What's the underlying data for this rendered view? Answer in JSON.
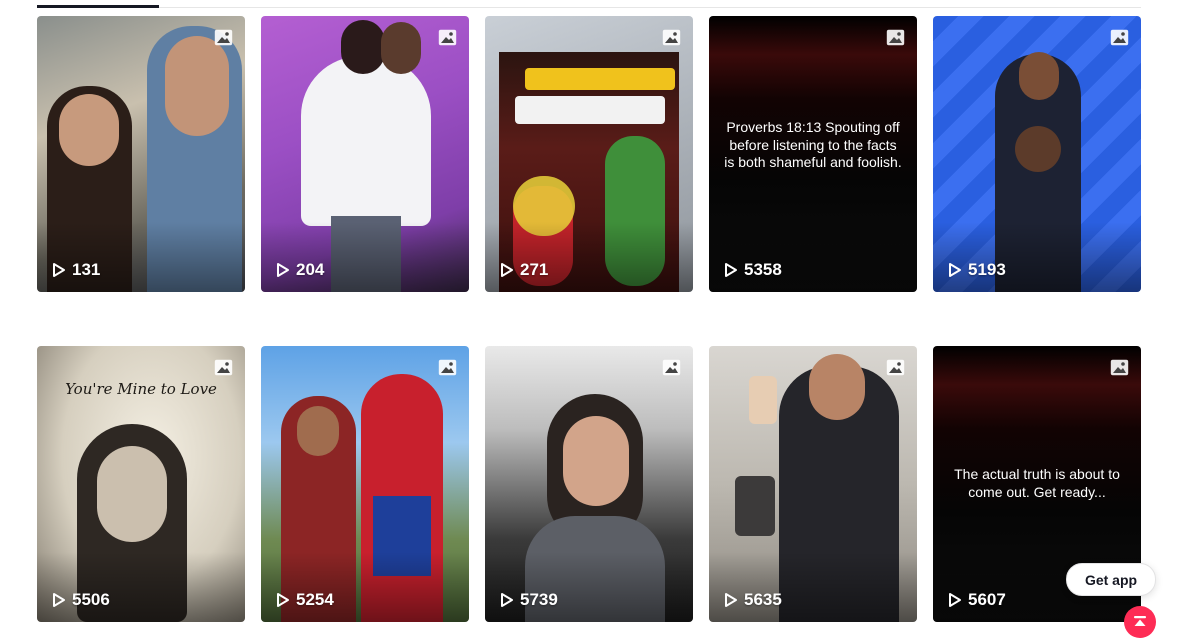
{
  "tabs": {
    "active_index": 0
  },
  "videos": [
    {
      "views": "131",
      "type": "photo"
    },
    {
      "views": "204",
      "type": "photo"
    },
    {
      "views": "271",
      "type": "photo"
    },
    {
      "views": "5358",
      "type": "photo",
      "caption": "Proverbs 18:13 Spouting off before listening to the facts is both shameful and foolish."
    },
    {
      "views": "5193",
      "type": "photo"
    },
    {
      "views": "5506",
      "type": "photo",
      "overlay_text": "You're Mine to Love"
    },
    {
      "views": "5254",
      "type": "photo"
    },
    {
      "views": "5739",
      "type": "photo"
    },
    {
      "views": "5635",
      "type": "photo"
    },
    {
      "views": "5607",
      "type": "photo",
      "caption": "The actual truth is about to come out. Get ready..."
    }
  ],
  "floating": {
    "get_app_label": "Get app",
    "back_to_top_icon": "arrow-up-icon"
  },
  "colors": {
    "accent": "#fe2c55",
    "text": "#161823"
  }
}
